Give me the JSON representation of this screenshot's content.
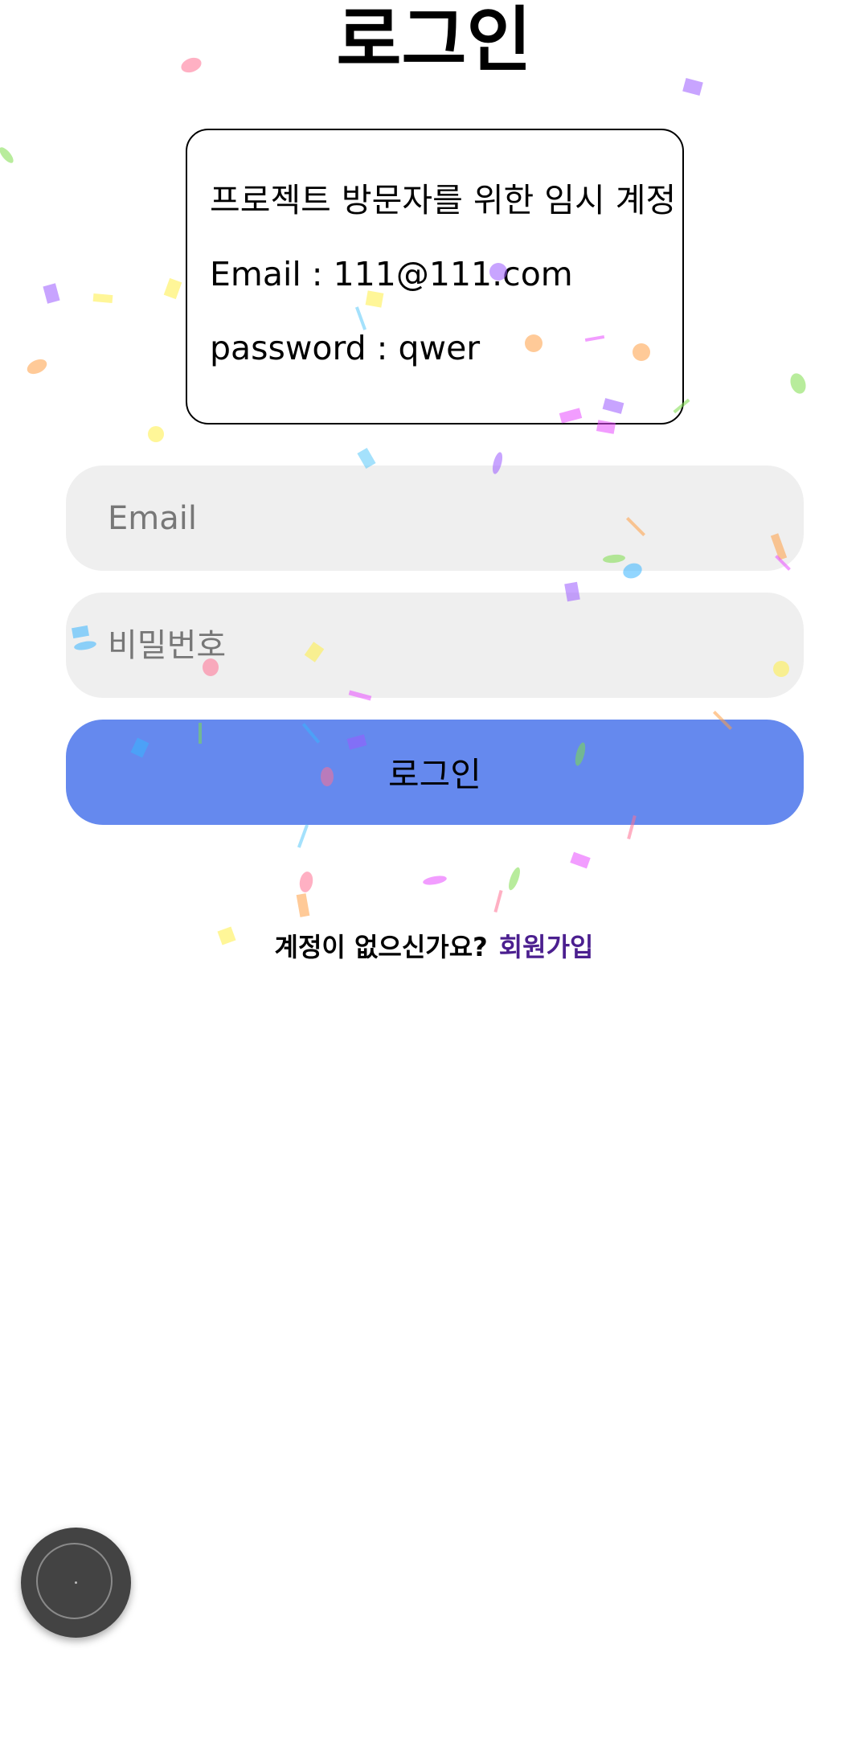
{
  "page": {
    "title": "로그인"
  },
  "info_box": {
    "heading": "프로젝트 방문자를 위한 임시 계정",
    "email_line": "Email : 111@111.com",
    "password_line": "password : qwer"
  },
  "form": {
    "email_placeholder": "Email",
    "password_placeholder": "비밀번호",
    "login_button_label": "로그인"
  },
  "signup": {
    "question": "계정이 없으신가요?",
    "link_label": "회원가입"
  },
  "colors": {
    "login_button": "#6589ee",
    "input_background": "#efefef",
    "signup_link": "#4b1f8f",
    "fab": "#434343"
  },
  "floating_button": {
    "icon": "assistive-touch-icon"
  }
}
